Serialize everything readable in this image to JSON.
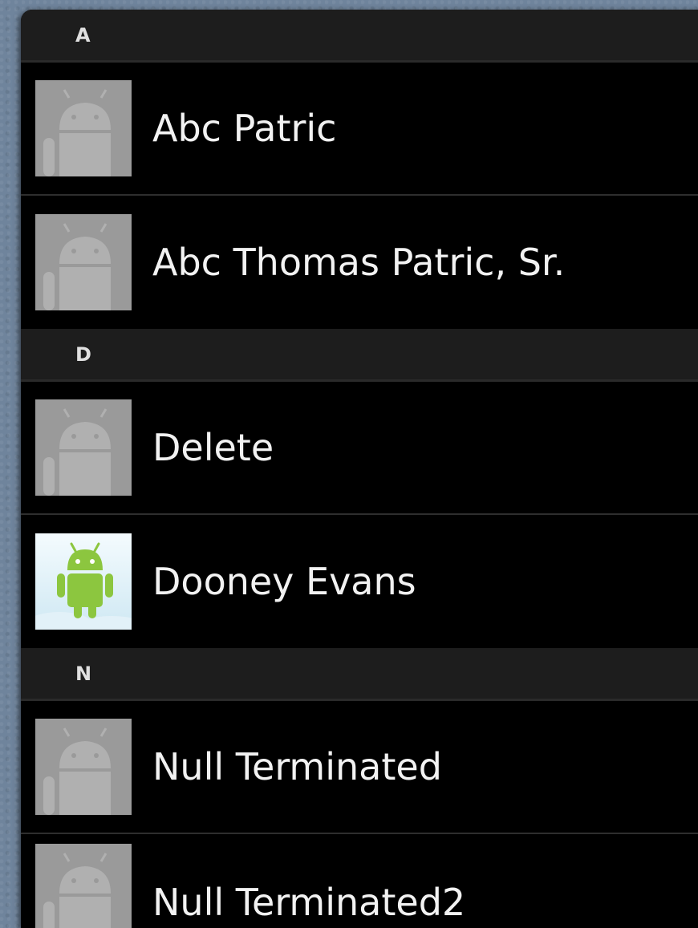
{
  "contacts_list": {
    "sections": [
      {
        "letter": "A",
        "contacts": [
          {
            "name": "Abc Patric",
            "avatar": "default-android-avatar-icon"
          },
          {
            "name": "Abc Thomas Patric, Sr.",
            "avatar": "default-android-avatar-icon"
          }
        ]
      },
      {
        "letter": "D",
        "contacts": [
          {
            "name": "Delete",
            "avatar": "default-android-avatar-icon"
          },
          {
            "name": "Dooney Evans",
            "avatar": "green-android-avatar-icon"
          }
        ]
      },
      {
        "letter": "N",
        "contacts": [
          {
            "name": "Null Terminated",
            "avatar": "default-android-avatar-icon"
          },
          {
            "name": "Null Terminated2",
            "avatar": "default-android-avatar-icon"
          }
        ]
      }
    ]
  },
  "colors": {
    "default_avatar_bg": "#9a9a9a",
    "default_avatar_figure": "#b3b3b3",
    "android_green": "#8cc63f",
    "custom_avatar_bg": "#e6f4fb"
  }
}
